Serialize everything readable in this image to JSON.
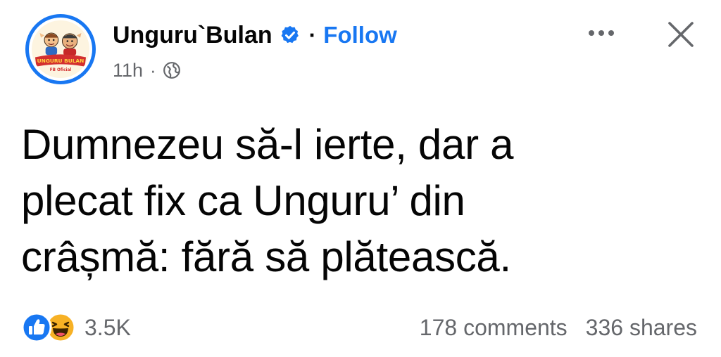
{
  "header": {
    "page_name": "Unguru`Bulan",
    "separator": "·",
    "follow_label": "Follow",
    "timestamp": "11h",
    "meta_separator": "·",
    "privacy_icon": "globe-icon",
    "verified_icon": "verified-badge-icon",
    "more_icon": "more-dots-icon",
    "close_icon": "close-icon",
    "avatar": {
      "logo_text_top": "UNGURU BULAN",
      "logo_text_bottom": "FB Oficial"
    }
  },
  "post": {
    "lines": [
      "Dumnezeu să-l ierte, dar a",
      "plecat fix ca Unguru’ din",
      "crâșmă: fără să plătească."
    ]
  },
  "footer": {
    "reaction_icons": [
      "like-icon",
      "haha-icon"
    ],
    "reaction_count": "3.5K",
    "comments": "178 comments",
    "shares": "336 shares"
  },
  "colors": {
    "accent": "#1877f2",
    "text": "#050505",
    "secondary_text": "#65676b",
    "haha_yellow": "#f7b125"
  }
}
